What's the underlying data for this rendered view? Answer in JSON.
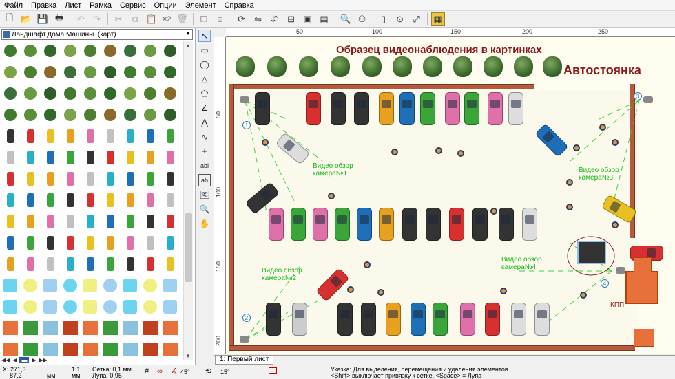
{
  "menu": [
    "Файл",
    "Правка",
    "Лист",
    "Рамка",
    "Сервис",
    "Опции",
    "Элемент",
    "Справка"
  ],
  "toolbar": {
    "x2_label": "×2"
  },
  "library": {
    "selected": "Ландшафт.Дома.Машины. (карт)"
  },
  "ruler_top": [
    "50",
    "100",
    "150",
    "200",
    "250"
  ],
  "ruler_left": [
    "50",
    "100",
    "150",
    "200"
  ],
  "plan": {
    "title": "Образец видеонаблюдения в картинках",
    "subtitle": "Автостоянка",
    "cam1": "Видео обзор камера№1",
    "cam2": "Видео обзор камера№2",
    "cam3": "Видео обзор камера№3",
    "cam4": "Видео обзор камера№4",
    "kpp": "КПП",
    "nums": [
      "1",
      "2",
      "3",
      "4"
    ]
  },
  "sheet_tab": "1: Первый лист",
  "status": {
    "coords": "X: 271,3",
    "coords2": "87,2",
    "scale": "1:1",
    "unit": "мм",
    "unit2": "мм",
    "grid": "Сетка: 0,1 мм",
    "zoom": "Лупа: 0,95",
    "angle1": "45°",
    "angle2": "15°",
    "hint1": "Указка: Для выделения, перемещения и удаления элементов.",
    "hint2": "<Shift> выключает привязку к сетке, <Space> = Лупа"
  },
  "colors": {
    "wall": "#b55a3c",
    "title": "#8b1a1a",
    "camtext": "#14b814"
  }
}
